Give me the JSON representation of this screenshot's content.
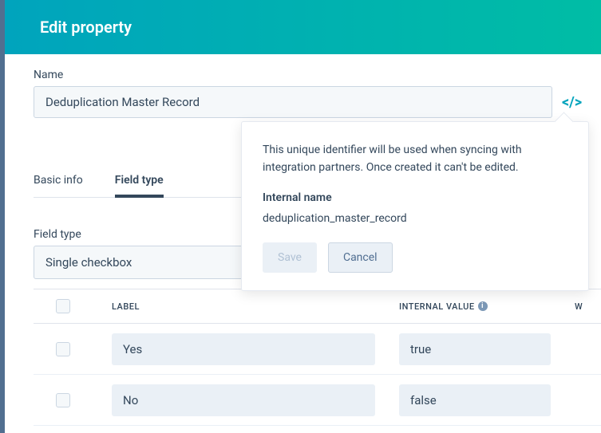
{
  "header": {
    "title": "Edit property"
  },
  "name_section": {
    "label": "Name",
    "value": "Deduplication Master Record"
  },
  "tabs": {
    "basic_info": "Basic info",
    "field_type": "Field type"
  },
  "field_type_section": {
    "label": "Field type",
    "value": "Single checkbox"
  },
  "table": {
    "headers": {
      "label": "LABEL",
      "internal": "INTERNAL VALUE",
      "w": "W"
    },
    "rows": [
      {
        "label": "Yes",
        "internal": "true"
      },
      {
        "label": "No",
        "internal": "false"
      }
    ]
  },
  "popover": {
    "description": "This unique identifier will be used when syncing with integration partners. Once created it can't be edited.",
    "internal_label": "Internal name",
    "internal_value": "deduplication_master_record",
    "save": "Save",
    "cancel": "Cancel"
  }
}
